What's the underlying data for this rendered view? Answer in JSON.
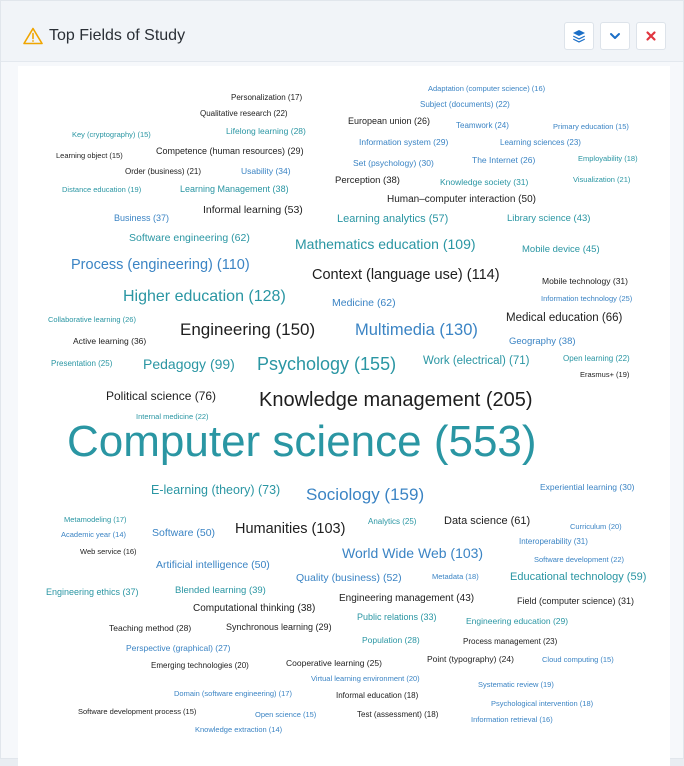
{
  "panel": {
    "title": "Top Fields of Study"
  },
  "toolbar": {
    "layers_icon": "layers-icon",
    "collapse_icon": "chevron-down-icon",
    "close_icon": "close-icon",
    "warning_icon": "warning-icon"
  },
  "colors": {
    "teal": "#2a96a3",
    "blue": "#3b84c4",
    "dark": "#1e1e1e",
    "close_red": "#e0353f",
    "warning": "#f0a500"
  },
  "words": [
    {
      "text": "Personalization (17)"
    },
    {
      "text": "Adaptation (computer science) (16)"
    },
    {
      "text": "Subject (documents) (22)"
    },
    {
      "text": "Qualitative research (22)"
    },
    {
      "text": "European union (26)"
    },
    {
      "text": "Teamwork (24)"
    },
    {
      "text": "Primary education (15)"
    },
    {
      "text": "Key (cryptography) (15)"
    },
    {
      "text": "Lifelong learning (28)"
    },
    {
      "text": "Information system (29)"
    },
    {
      "text": "Learning sciences (23)"
    },
    {
      "text": "Learning object (15)"
    },
    {
      "text": "Competence (human resources) (29)"
    },
    {
      "text": "Set (psychology) (30)"
    },
    {
      "text": "The Internet (26)"
    },
    {
      "text": "Employability (18)"
    },
    {
      "text": "Order (business) (21)"
    },
    {
      "text": "Usability (34)"
    },
    {
      "text": "Perception (38)"
    },
    {
      "text": "Knowledge society (31)"
    },
    {
      "text": "Visualization (21)"
    },
    {
      "text": "Distance education (19)"
    },
    {
      "text": "Learning Management (38)"
    },
    {
      "text": "Human–computer interaction (50)"
    },
    {
      "text": "Informal learning (53)"
    },
    {
      "text": "Business (37)"
    },
    {
      "text": "Learning analytics (57)"
    },
    {
      "text": "Library science (43)"
    },
    {
      "text": "Software engineering (62)"
    },
    {
      "text": "Mathematics education (109)"
    },
    {
      "text": "Mobile device (45)"
    },
    {
      "text": "Process (engineering) (110)"
    },
    {
      "text": "Context (language use) (114)"
    },
    {
      "text": "Mobile technology (31)"
    },
    {
      "text": "Higher education (128)"
    },
    {
      "text": "Medicine (62)"
    },
    {
      "text": "Information technology (25)"
    },
    {
      "text": "Collaborative learning (26)"
    },
    {
      "text": "Medical education (66)"
    },
    {
      "text": "Engineering (150)"
    },
    {
      "text": "Multimedia (130)"
    },
    {
      "text": "Active learning (36)"
    },
    {
      "text": "Geography (38)"
    },
    {
      "text": "Presentation (25)"
    },
    {
      "text": "Pedagogy (99)"
    },
    {
      "text": "Psychology (155)"
    },
    {
      "text": "Work (electrical) (71)"
    },
    {
      "text": "Open learning (22)"
    },
    {
      "text": "Erasmus+ (19)"
    },
    {
      "text": "Political science (76)"
    },
    {
      "text": "Knowledge management (205)"
    },
    {
      "text": "Internal medicine (22)"
    },
    {
      "text": "Computer science (553)"
    },
    {
      "text": "E-learning (theory) (73)"
    },
    {
      "text": "Sociology (159)"
    },
    {
      "text": "Experiential learning (30)"
    },
    {
      "text": "Metamodeling (17)"
    },
    {
      "text": "Analytics (25)"
    },
    {
      "text": "Data science (61)"
    },
    {
      "text": "Curriculum (20)"
    },
    {
      "text": "Academic year (14)"
    },
    {
      "text": "Software (50)"
    },
    {
      "text": "Humanities (103)"
    },
    {
      "text": "Interoperability (31)"
    },
    {
      "text": "Web service (16)"
    },
    {
      "text": "World Wide Web (103)"
    },
    {
      "text": "Software development (22)"
    },
    {
      "text": "Artificial intelligence (50)"
    },
    {
      "text": "Quality (business) (52)"
    },
    {
      "text": "Metadata (18)"
    },
    {
      "text": "Educational technology (59)"
    },
    {
      "text": "Engineering ethics (37)"
    },
    {
      "text": "Blended learning (39)"
    },
    {
      "text": "Engineering management (43)"
    },
    {
      "text": "Field (computer science) (31)"
    },
    {
      "text": "Computational thinking (38)"
    },
    {
      "text": "Public relations (33)"
    },
    {
      "text": "Engineering education (29)"
    },
    {
      "text": "Teaching method (28)"
    },
    {
      "text": "Synchronous learning (29)"
    },
    {
      "text": "Population (28)"
    },
    {
      "text": "Process management (23)"
    },
    {
      "text": "Perspective (graphical) (27)"
    },
    {
      "text": "Point (typography) (24)"
    },
    {
      "text": "Cloud computing (15)"
    },
    {
      "text": "Emerging technologies (20)"
    },
    {
      "text": "Cooperative learning (25)"
    },
    {
      "text": "Virtual learning environment (20)"
    },
    {
      "text": "Systematic review (19)"
    },
    {
      "text": "Domain (software engineering) (17)"
    },
    {
      "text": "Informal education (18)"
    },
    {
      "text": "Psychological intervention (18)"
    },
    {
      "text": "Software development process (15)"
    },
    {
      "text": "Open science (15)"
    },
    {
      "text": "Test (assessment) (18)"
    },
    {
      "text": "Information retrieval (16)"
    },
    {
      "text": "Knowledge extraction (14)"
    }
  ]
}
